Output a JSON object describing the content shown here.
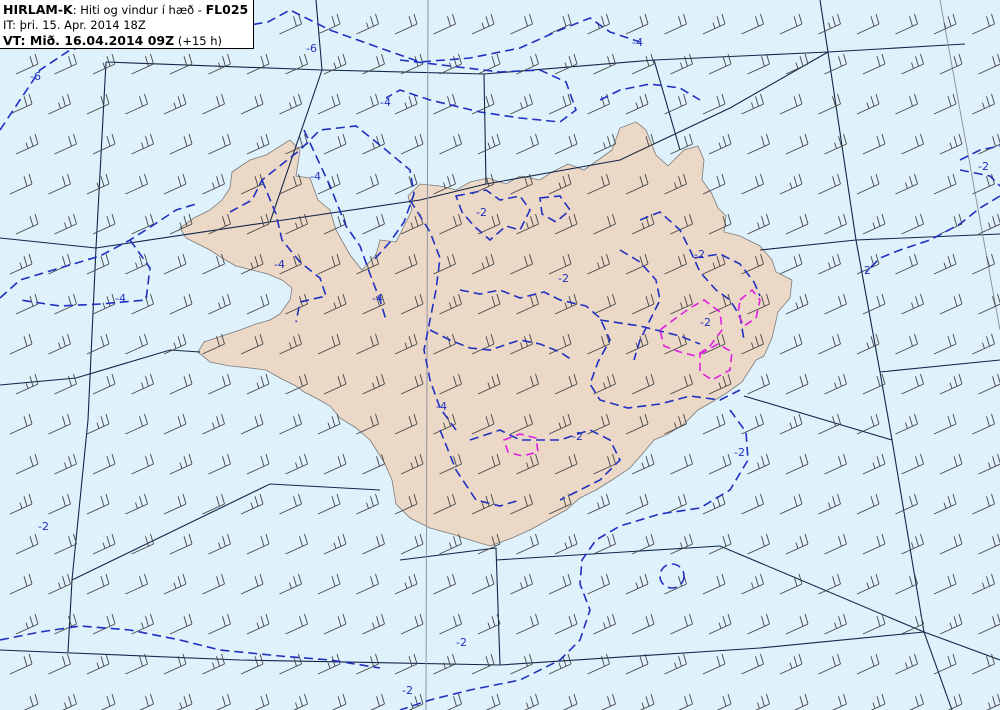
{
  "title": {
    "model": "HIRLAM-K",
    "description": ": Hiti og vindur í hæð - ",
    "level": "FL025",
    "issue_time": "IT: þri. 15. Apr. 2014 18Z",
    "valid_prefix": "VT: ",
    "valid_time": "Mið. 16.04.2014 09Z",
    "valid_offset": " (+15 h)"
  },
  "colors": {
    "sea": "#dff2fb",
    "land": "#ecd8c6",
    "coast": "#7a7a7a",
    "contour_blue": "#2030c0",
    "contour_magenta": "#e020e0",
    "grid": "#13264a",
    "barb": "#444444"
  },
  "contour_labels": [
    {
      "text": "-6"
    },
    {
      "text": "-6"
    },
    {
      "text": "-4"
    },
    {
      "text": "-4"
    },
    {
      "text": "-4"
    },
    {
      "text": "-4"
    },
    {
      "text": "-4"
    },
    {
      "text": "-4"
    },
    {
      "text": "-2"
    },
    {
      "text": "-2"
    },
    {
      "text": "-2"
    },
    {
      "text": "-2"
    },
    {
      "text": "-2"
    },
    {
      "text": "-2"
    },
    {
      "text": "-2"
    },
    {
      "text": "-2"
    },
    {
      "text": "-2"
    },
    {
      "text": "-4"
    },
    {
      "text": "-2"
    },
    {
      "text": "-2"
    }
  ]
}
